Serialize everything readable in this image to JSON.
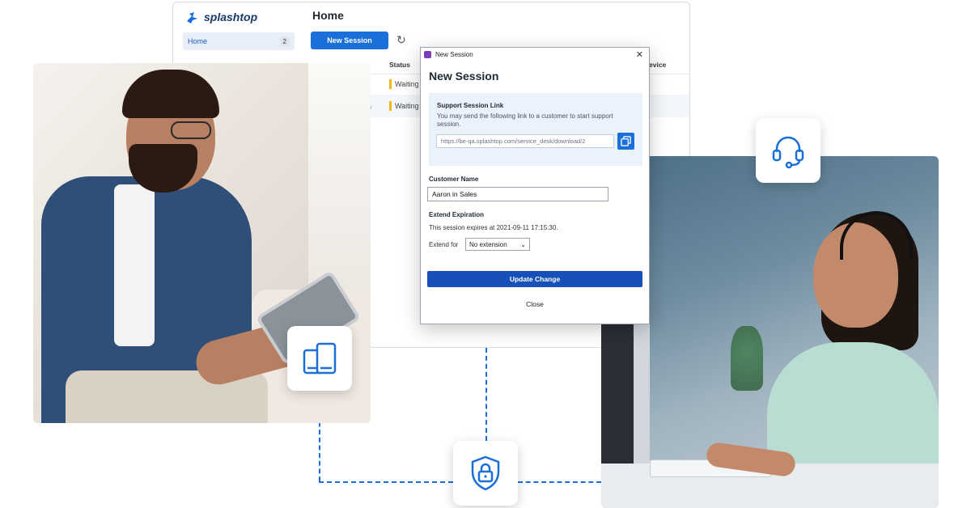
{
  "app": {
    "brand": "splashtop",
    "page_title": "Home",
    "sidebar": {
      "home_label": "Home",
      "home_count": "2"
    },
    "toolbar": {
      "new_session_label": "New Session"
    },
    "table": {
      "status_header": "Status",
      "device_header": "evice",
      "rows": [
        {
          "status": "Waiting",
          "status_color": "#f2b71d"
        },
        {
          "prefix": "g)",
          "status": "Waiting",
          "status_color": "#f2b71d"
        }
      ]
    }
  },
  "dialog": {
    "window_title": "New Session",
    "heading": "New Session",
    "support_link": {
      "title": "Support Session Link",
      "description": "You may send the following link to a customer to start support session.",
      "url": "https://be-qa.splashtop.com/service_desk/download/2"
    },
    "customer_name": {
      "label": "Customer Name",
      "value": "Aaron in Sales"
    },
    "extend": {
      "title": "Extend Expiration",
      "expiry_text": "This session expires at 2021-09-11 17:15:30.",
      "label": "Extend for",
      "selected": "No extension"
    },
    "update_button": "Update Change",
    "close_button": "Close"
  },
  "icons": [
    "devices-icon",
    "headset-icon",
    "lock-shield-icon",
    "copy-icon",
    "refresh-icon",
    "splashtop-logo-icon"
  ],
  "colors": {
    "accent": "#1a6fd9",
    "dialog_primary": "#1650b8",
    "waiting": "#f2b71d"
  }
}
